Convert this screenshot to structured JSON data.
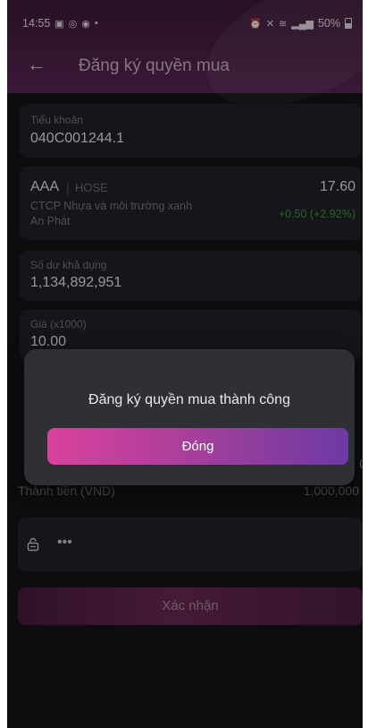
{
  "status_bar": {
    "time": "14:55",
    "battery": "50%"
  },
  "header": {
    "title": "Đăng ký quyền mua"
  },
  "account": {
    "label": "Tiểu khoản",
    "value": "040C001244.1"
  },
  "stock": {
    "symbol": "AAA",
    "separator": "|",
    "exchange": "HOSE",
    "company_line1": "CTCP Nhựa và môi trường xanh",
    "company_line2": "An Phát",
    "price": "17.60",
    "change": "+0.50 (+2.92%)",
    "change_color": "#2e9e3a"
  },
  "balance": {
    "label": "Số dư khả dụng",
    "value": "1,134,892,951"
  },
  "price_field": {
    "label": "Giá (x1000)",
    "value": "10.00"
  },
  "quantity_partial": "0",
  "total": {
    "label": "Thành tiền (VND)",
    "value": "1,000,000"
  },
  "password": {
    "value": "•••"
  },
  "confirm_button": {
    "label": "Xác nhận"
  },
  "dialog": {
    "message": "Đăng ký quyền mua thành công",
    "button_label": "Đóng"
  }
}
